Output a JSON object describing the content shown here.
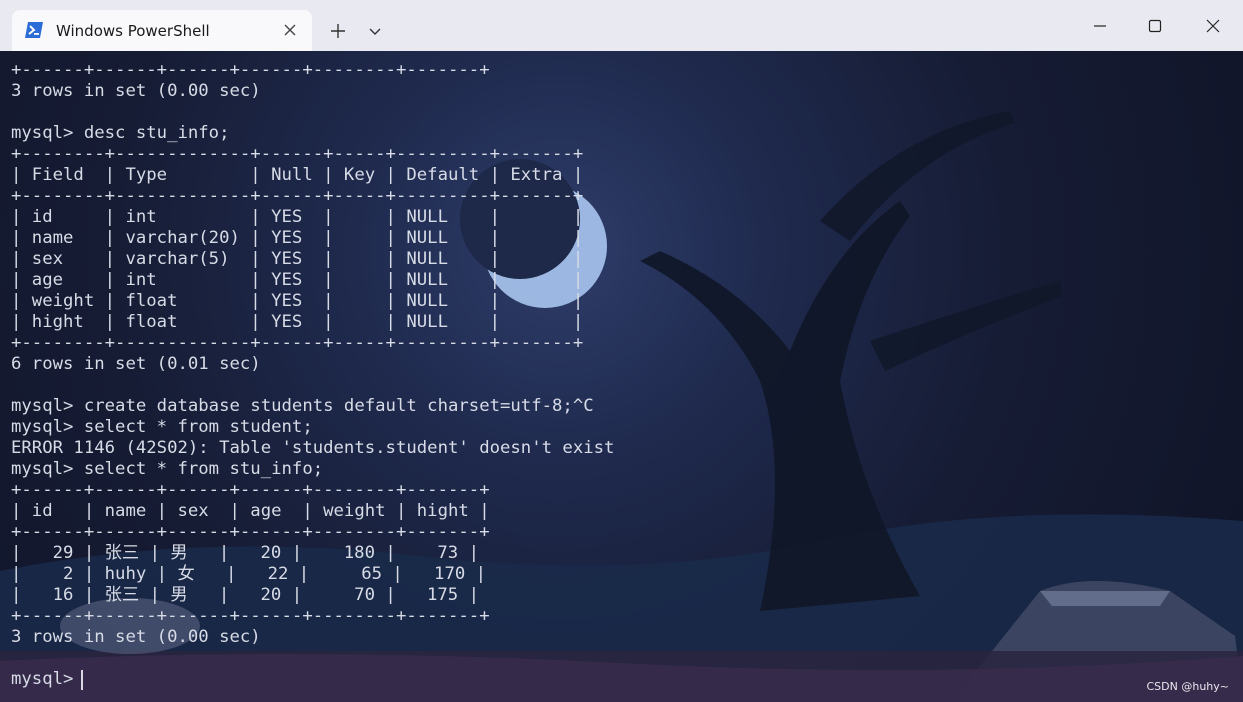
{
  "tab": {
    "title": "Windows PowerShell",
    "icon": "powershell-icon",
    "close_icon": "close-icon"
  },
  "titlebar": {
    "new_tab_icon": "plus-icon",
    "dropdown_icon": "chevron-down-icon",
    "minimize_icon": "minimize-icon",
    "maximize_icon": "maximize-icon",
    "close_icon": "close-icon"
  },
  "terminal": {
    "lines": [
      "+------+------+------+------+--------+-------+",
      "3 rows in set (0.00 sec)",
      "",
      "mysql> desc stu_info;",
      "+--------+-------------+------+-----+---------+-------+",
      "| Field  | Type        | Null | Key | Default | Extra |",
      "+--------+-------------+------+-----+---------+-------+",
      "| id     | int         | YES  |     | NULL    |       |",
      "| name   | varchar(20) | YES  |     | NULL    |       |",
      "| sex    | varchar(5)  | YES  |     | NULL    |       |",
      "| age    | int         | YES  |     | NULL    |       |",
      "| weight | float       | YES  |     | NULL    |       |",
      "| hight  | float       | YES  |     | NULL    |       |",
      "+--------+-------------+------+-----+---------+-------+",
      "6 rows in set (0.01 sec)",
      "",
      "mysql> create database students default charset=utf-8;^C",
      "mysql> select * from student;",
      "ERROR 1146 (42S02): Table 'students.student' doesn't exist",
      "mysql> select * from stu_info;",
      "+------+------+------+------+--------+-------+",
      "| id   | name | sex  | age  | weight | hight |",
      "+------+------+------+------+--------+-------+",
      "|   29 | 张三 | 男   |   20 |    180 |    73 |",
      "|    2 | huhy | 女   |   22 |     65 |   170 |",
      "|   16 | 张三 | 男   |   20 |     70 |   175 |",
      "+------+------+------+------+--------+-------+",
      "3 rows in set (0.00 sec)",
      "",
      "mysql> "
    ]
  },
  "watermark": "CSDN @huhy~",
  "colors": {
    "titlebar": "#e9eaf1",
    "tab": "#f9f9fb",
    "terminal_text": "#d7dbe6",
    "moon": "#a9c6ef"
  }
}
